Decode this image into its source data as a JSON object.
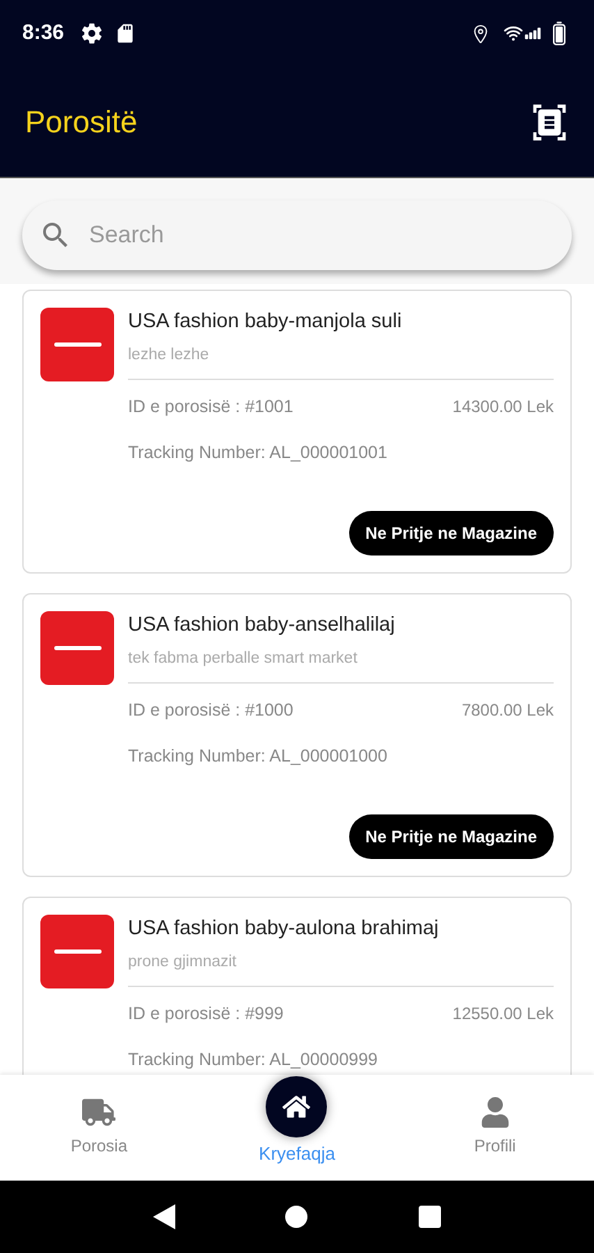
{
  "status_bar": {
    "time": "8:36"
  },
  "app_bar": {
    "title": "Porositë"
  },
  "search": {
    "placeholder": "Search"
  },
  "orders": [
    {
      "title": "USA fashion baby-manjola suli",
      "address": "lezhe lezhe",
      "order_id": "ID e porosisë : #1001",
      "amount": "14300.00 Lek",
      "tracking": "Tracking Number: AL_000001001",
      "status": "Ne Pritje ne Magazine"
    },
    {
      "title": "USA fashion baby-anselhalilaj",
      "address": "tek fabma perballe smart market",
      "order_id": "ID e porosisë : #1000",
      "amount": "7800.00 Lek",
      "tracking": "Tracking Number: AL_000001000",
      "status": "Ne Pritje ne Magazine"
    },
    {
      "title": "USA fashion baby-aulona brahimaj",
      "address": "prone gjimnazit",
      "order_id": "ID e porosisë : #999",
      "amount": "12550.00 Lek",
      "tracking": "Tracking Number: AL_00000999"
    }
  ],
  "bottom_nav": [
    {
      "kind": "truck",
      "label": "Porosia",
      "selected": false
    },
    {
      "kind": "home",
      "label": "Kryefaqja",
      "selected": true
    },
    {
      "kind": "person",
      "label": "Profili",
      "selected": false
    }
  ]
}
